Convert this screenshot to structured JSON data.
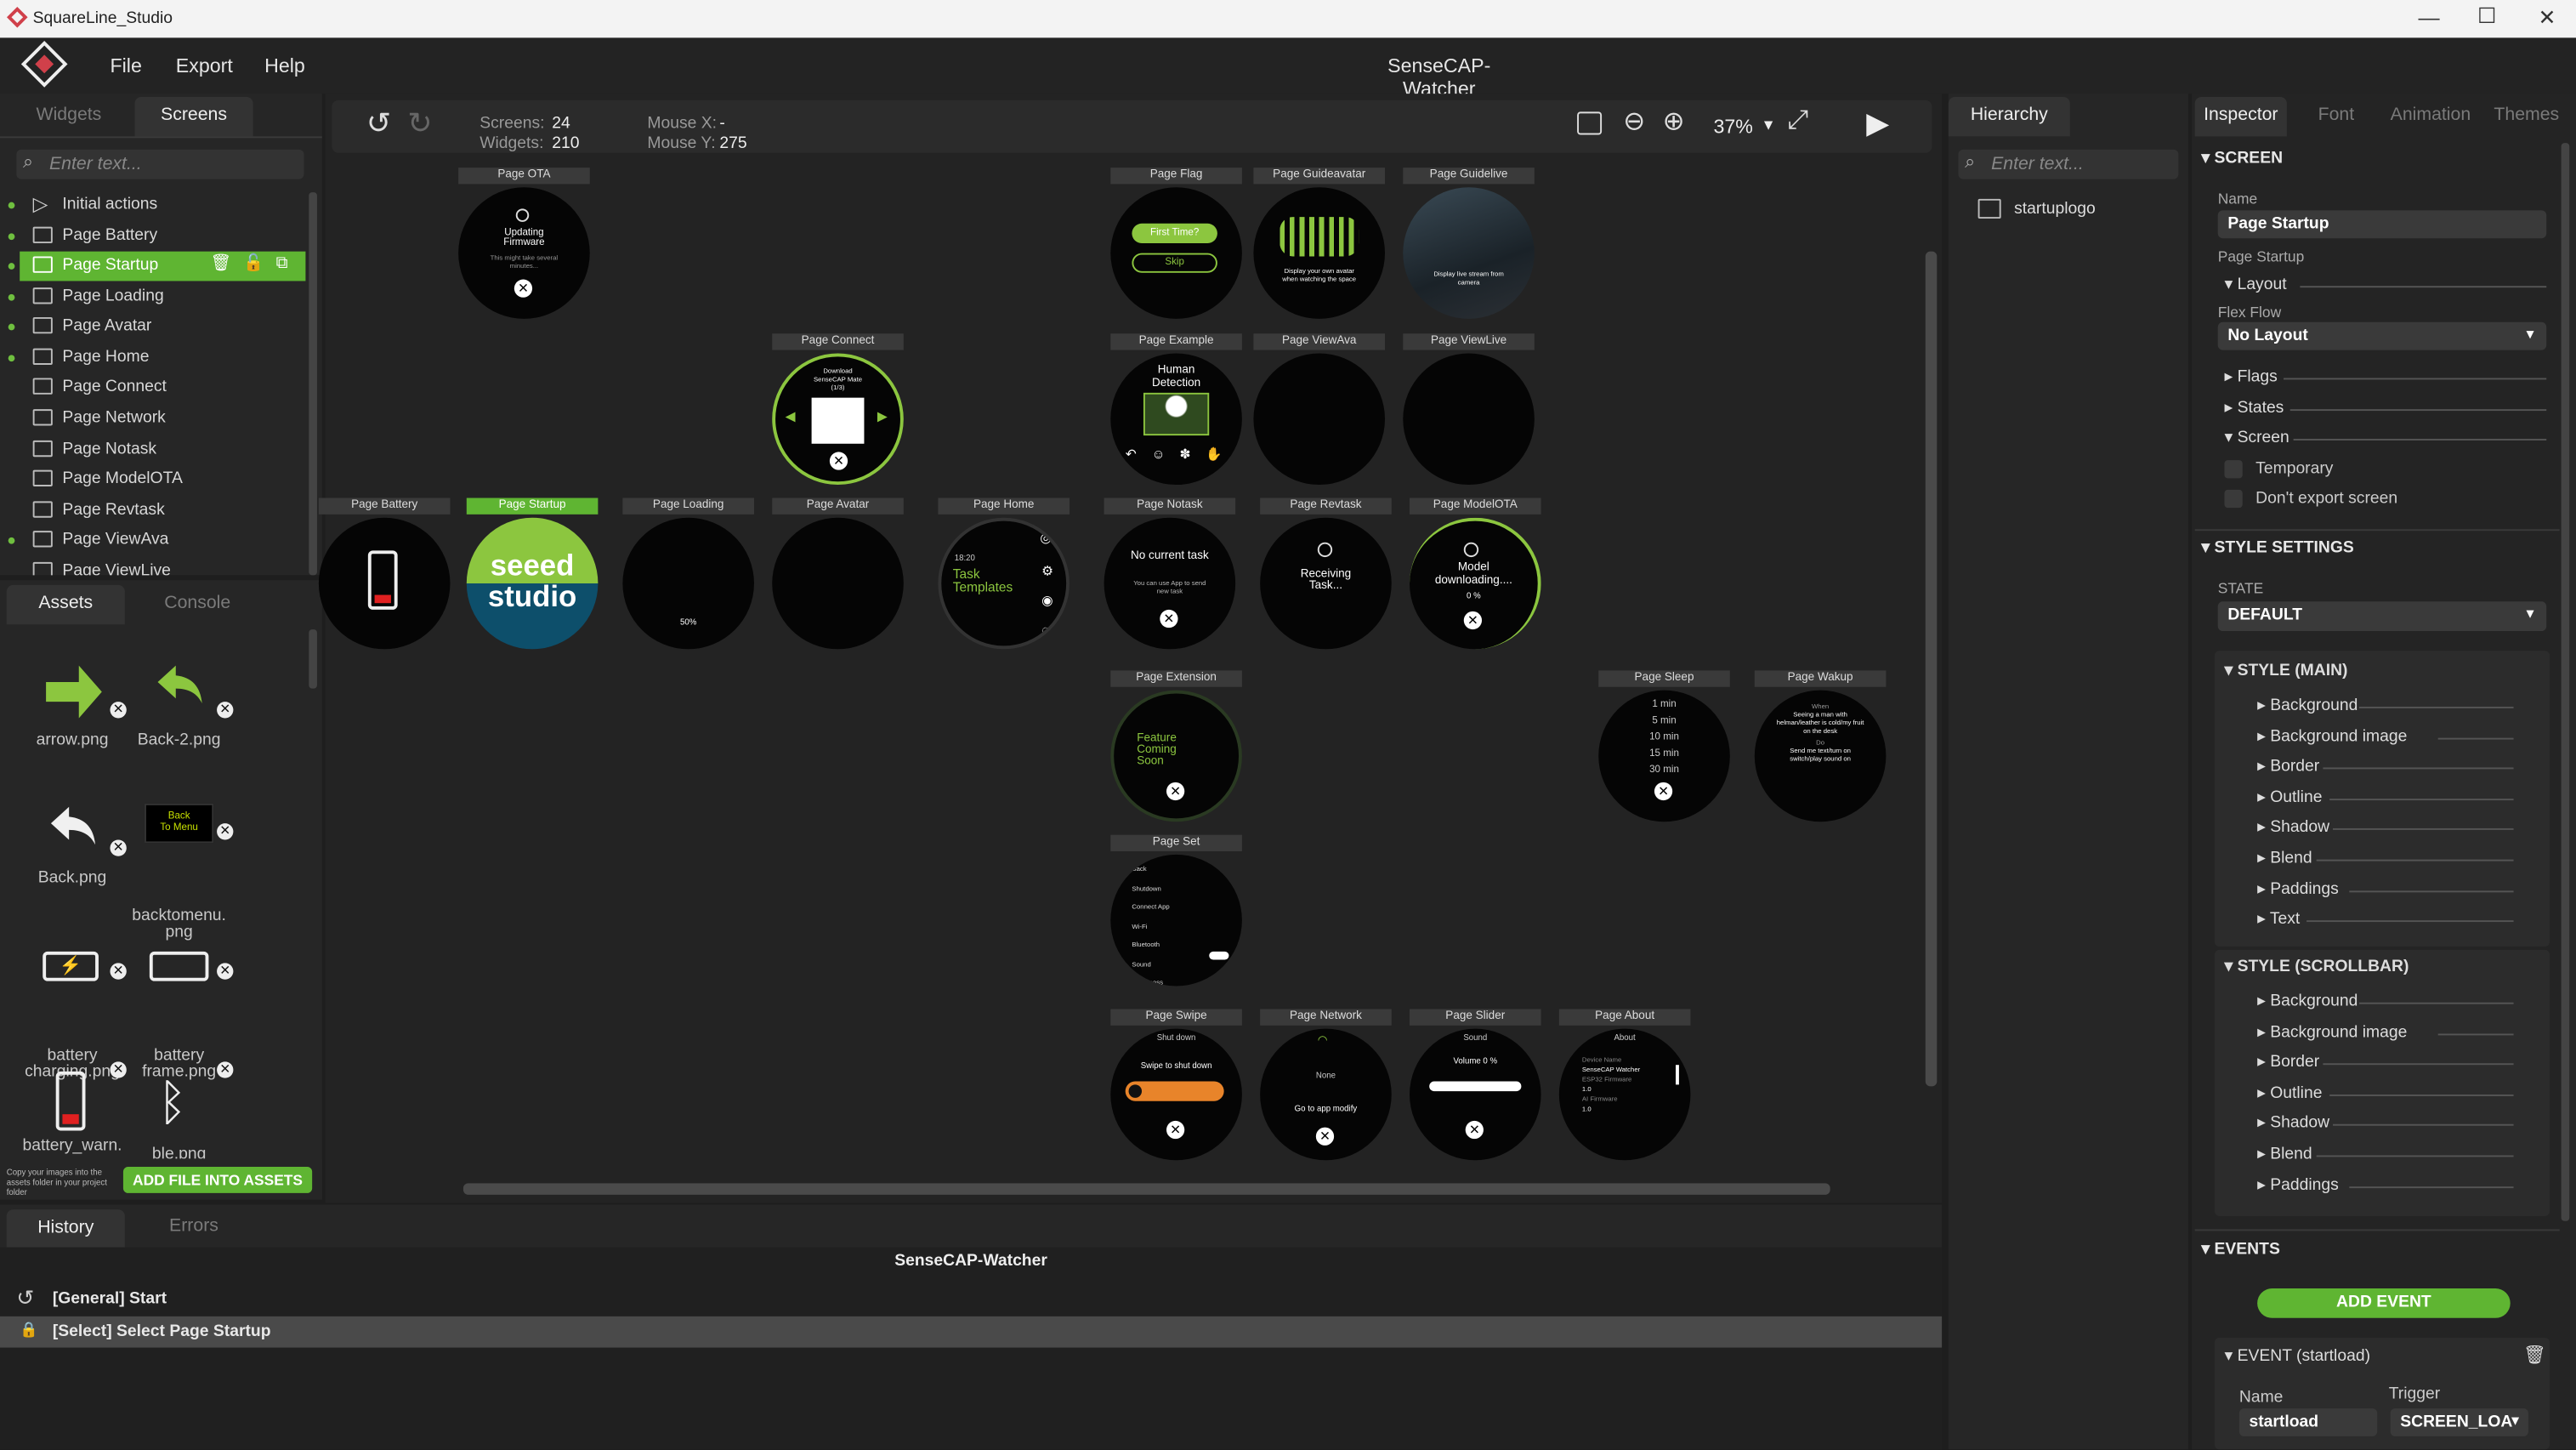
{
  "window": {
    "title": "SquareLine_Studio"
  },
  "menu": {
    "file": "File",
    "export": "Export",
    "help": "Help",
    "project": "SenseCAP-Watcher"
  },
  "left_tabs": {
    "widgets": "Widgets",
    "screens": "Screens"
  },
  "screen_search": {
    "placeholder": "Enter text..."
  },
  "screen_list": [
    {
      "label": "Initial actions"
    },
    {
      "label": "Page Battery"
    },
    {
      "label": "Page Startup"
    },
    {
      "label": "Page Loading"
    },
    {
      "label": "Page Avatar"
    },
    {
      "label": "Page Home"
    },
    {
      "label": "Page Connect"
    },
    {
      "label": "Page Network"
    },
    {
      "label": "Page Notask"
    },
    {
      "label": "Page ModelOTA"
    },
    {
      "label": "Page Revtask"
    },
    {
      "label": "Page ViewAva"
    },
    {
      "label": "Page ViewLive"
    }
  ],
  "asset_tabs": {
    "assets": "Assets",
    "console": "Console"
  },
  "assets": [
    {
      "name": "arrow.png"
    },
    {
      "name": "Back-2.png"
    },
    {
      "name": "Back.png"
    },
    {
      "name": "backtomenu.\npng",
      "thumb_text": "Back\nTo Menu"
    },
    {
      "name": "battery\ncharging.png"
    },
    {
      "name": "battery\nframe.png"
    },
    {
      "name": "battery_warn."
    },
    {
      "name": "ble.png"
    }
  ],
  "assets_footer": {
    "hint": "Copy your images into the assets folder in your project folder",
    "add_button": "ADD FILE INTO ASSETS"
  },
  "toolbar": {
    "screens_label": "Screens:",
    "screens_value": "24",
    "widgets_label": "Widgets:",
    "widgets_value": "210",
    "mouse_x_label": "Mouse X:",
    "mouse_x_value": "-",
    "mouse_y_label": "Mouse Y:",
    "mouse_y_value": "275",
    "zoom": "37%"
  },
  "screens": {
    "ota": {
      "label": "Page OTA",
      "line1": "Updating",
      "line2": "Firmware",
      "small": "This might take several minutes..."
    },
    "flag": {
      "label": "Page Flag",
      "btn1": "First Time?",
      "btn2": "Skip"
    },
    "guideavatar": {
      "label": "Page Guideavatar",
      "text": "Display your own avatar when watching the space"
    },
    "guidelive": {
      "label": "Page Guidelive",
      "text": "Display live stream from camera"
    },
    "connect": {
      "label": "Page Connect",
      "text": "Download SenseCAP Mate",
      "pager": "(1/3)"
    },
    "example": {
      "label": "Page Example",
      "text": "Human Detection"
    },
    "viewava": {
      "label": "Page ViewAva"
    },
    "viewlive": {
      "label": "Page ViewLive"
    },
    "battery": {
      "label": "Page Battery"
    },
    "startup": {
      "label": "Page Startup",
      "line1": "seeed",
      "line2": "studio"
    },
    "loading": {
      "label": "Page Loading",
      "pct": "50%"
    },
    "avatar": {
      "label": "Page Avatar"
    },
    "home": {
      "label": "Page Home",
      "time": "18:20",
      "line1": "Task",
      "line2": "Templates"
    },
    "notask": {
      "label": "Page Notask",
      "title": "No current task",
      "small": "You can use App to send new task"
    },
    "revtask": {
      "label": "Page Revtask",
      "text": "Receiving Task..."
    },
    "modelota": {
      "label": "Page ModelOTA",
      "line1": "Model",
      "line2": "downloading....",
      "pct": "0 %"
    },
    "extension": {
      "label": "Page Extension",
      "line1": "Feature",
      "line2": "Coming",
      "line3": "Soon"
    },
    "sleep": {
      "label": "Page Sleep",
      "options": [
        "1 min",
        "5 min",
        "10 min",
        "15 min",
        "30 min"
      ]
    },
    "wakeup": {
      "label": "Page Wakup",
      "when": "When",
      "cond": "Seeing a man with helman/leather is cold/my fruit on the desk",
      "do": "Do",
      "action": "Send me text/turn on switch/play sound on"
    },
    "set": {
      "label": "Page Set",
      "items": [
        "Back",
        "Shutdown",
        "Connect App",
        "Wi-Fi",
        "Bluetooth",
        "Sound",
        "Brightness"
      ]
    },
    "swipe": {
      "label": "Page Swipe",
      "title": "Shut down",
      "text": "Swipe to shut down"
    },
    "network": {
      "label": "Page Network",
      "value": "None",
      "text": "Go to app modify"
    },
    "slider": {
      "label": "Page Slider",
      "title": "Sound",
      "text": "Volume 0 %"
    },
    "about": {
      "label": "Page About",
      "title": "About",
      "f1": "Device Name",
      "v1": "SenseCAP Watcher",
      "f2": "ESP32 Firmware",
      "v2": "1.0",
      "f3": "AI Firmware",
      "v3": "1.0"
    }
  },
  "history_tabs": {
    "history": "History",
    "errors": "Errors"
  },
  "history": {
    "title": "SenseCAP-Watcher",
    "items": [
      "[General] Start",
      "[Select] Select Page Startup"
    ]
  },
  "hierarchy": {
    "tab": "Hierarchy",
    "placeholder": "Enter text...",
    "items": [
      "startuplogo"
    ]
  },
  "inspector_tabs": {
    "inspector": "Inspector",
    "font": "Font",
    "animation": "Animation",
    "themes": "Themes"
  },
  "inspector": {
    "screen_header": "SCREEN",
    "name_label": "Name",
    "name_value": "Page Startup",
    "type_label": "Page Startup",
    "layout": "Layout",
    "flex_flow": "Flex Flow",
    "layout_value": "No Layout",
    "flags": "Flags",
    "states": "States",
    "screen": "Screen",
    "temporary": "Temporary",
    "dont_export": "Don't export screen",
    "style_settings": "STYLE SETTINGS",
    "state_label": "STATE",
    "state_value": "DEFAULT",
    "style_main": "STYLE (MAIN)",
    "main_props": [
      "Background",
      "Background image",
      "Border",
      "Outline",
      "Shadow",
      "Blend",
      "Paddings",
      "Text"
    ],
    "style_scrollbar": "STYLE (SCROLLBAR)",
    "scroll_props": [
      "Background",
      "Background image",
      "Border",
      "Outline",
      "Shadow",
      "Blend",
      "Paddings"
    ],
    "events": "EVENTS",
    "add_event": "ADD EVENT",
    "event_title": "EVENT (startload)",
    "event_name_label": "Name",
    "event_trigger_label": "Trigger",
    "event_name_value": "startload",
    "event_trigger_value": "SCREEN_LOA"
  },
  "colors": {
    "accent": "#5fb532",
    "seeed_green": "#8cc63f",
    "seeed_blue": "#0d4f6b"
  }
}
